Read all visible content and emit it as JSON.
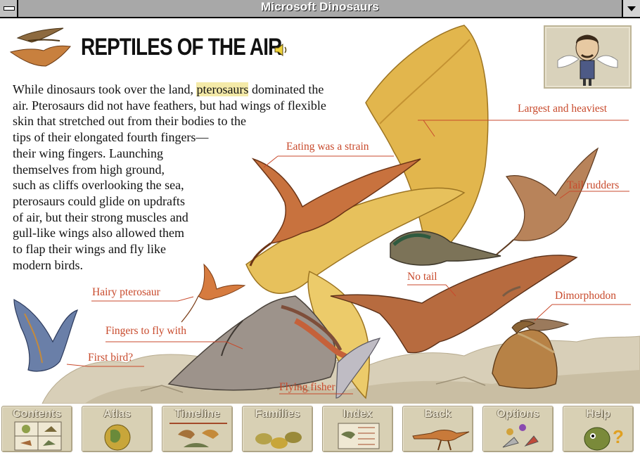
{
  "window": {
    "title": "Microsoft Dinosaurs"
  },
  "page": {
    "heading": "REPTILES OF THE AIR",
    "body_lines": [
      [
        "While dinosaurs took over the land, ",
        "pterosaurs",
        " dominated the"
      ],
      "air. Pterosaurs did not have feathers, but had wings of flexible",
      "skin that stretched out from their bodies to the",
      "tips of their elongated fourth fingers—",
      "their wing fingers. Launching",
      "themselves from high ground,",
      "such as cliffs overlooking the sea,",
      "pterosaurs could glide on updrafts",
      "of air, but their strong muscles and",
      "gull-like wings also allowed them",
      "to flap their wings and fly like",
      "modern birds."
    ]
  },
  "labels": {
    "largest": "Largest and heaviest",
    "eating": "Eating was a strain",
    "tail_rudders": "Tail rudders",
    "no_tail": "No tail",
    "hairy": "Hairy pterosaur",
    "dimorphodon": "Dimorphodon",
    "fingers": "Fingers to fly with",
    "first_bird": "First bird?",
    "flying_fisher": "Flying fisher"
  },
  "toolbar": [
    {
      "label": "Contents",
      "icon": "contents-icon"
    },
    {
      "label": "Atlas",
      "icon": "globe-icon"
    },
    {
      "label": "Timeline",
      "icon": "timeline-icon"
    },
    {
      "label": "Families",
      "icon": "families-icon"
    },
    {
      "label": "Index",
      "icon": "index-icon"
    },
    {
      "label": "Back",
      "icon": "back-dinosaur-icon"
    },
    {
      "label": "Options",
      "icon": "options-icon"
    },
    {
      "label": "Help",
      "icon": "help-dinosaur-icon"
    }
  ],
  "colors": {
    "label": "#c84a2c",
    "highlight": "#f4eaa8",
    "button_bg": "#d8d0b4",
    "titlebar": "#a8a8a8"
  }
}
